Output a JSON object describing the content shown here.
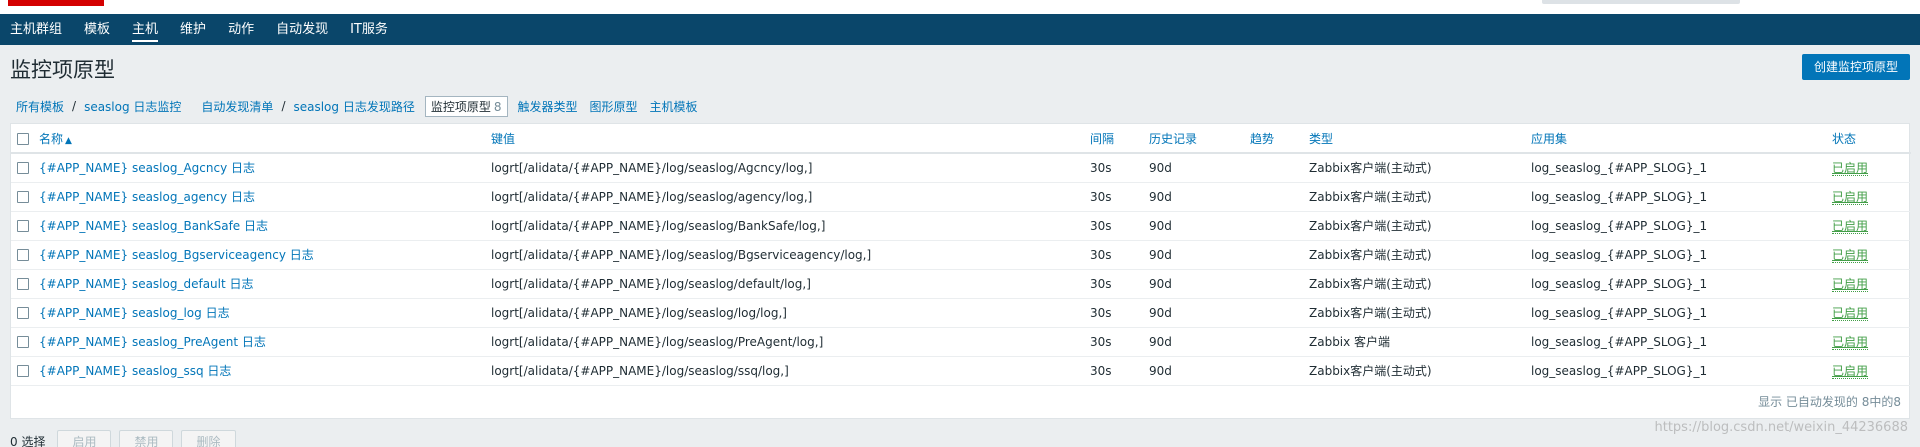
{
  "nav": {
    "items": [
      {
        "label": "主机群组",
        "active": false
      },
      {
        "label": "模板",
        "active": false
      },
      {
        "label": "主机",
        "active": true
      },
      {
        "label": "维护",
        "active": false
      },
      {
        "label": "动作",
        "active": false
      },
      {
        "label": "自动发现",
        "active": false
      },
      {
        "label": "IT服务",
        "active": false
      }
    ]
  },
  "page": {
    "title": "监控项原型",
    "create_button": "创建监控项原型"
  },
  "breadcrumbs": {
    "all_templates": "所有模板",
    "sep": "/",
    "template": "seaslog 日志监控",
    "discovery_list": "自动发现清单",
    "discovery_rule": "seaslog 日志发现路径",
    "current_tab": "监控项原型",
    "current_count": "8",
    "trigger_prototypes": "触发器类型",
    "graph_prototypes": "图形原型",
    "host_prototypes": "主机模板"
  },
  "table": {
    "headers": {
      "name": "名称",
      "sort_indicator": "▲",
      "key": "键值",
      "interval": "间隔",
      "history": "历史记录",
      "trends": "趋势",
      "type": "类型",
      "applications": "应用集",
      "status": "状态"
    },
    "rows": [
      {
        "name": "{#APP_NAME} seaslog_Agcncy 日志",
        "key": "logrt[/alidata/{#APP_NAME}/log/seaslog/Agcncy/log,]",
        "interval": "30s",
        "history": "90d",
        "trends": "",
        "type": "Zabbix客户端(主动式)",
        "app": "log_seaslog_{#APP_SLOG}_1",
        "status": "已启用"
      },
      {
        "name": "{#APP_NAME} seaslog_agency 日志",
        "key": "logrt[/alidata/{#APP_NAME}/log/seaslog/agency/log,]",
        "interval": "30s",
        "history": "90d",
        "trends": "",
        "type": "Zabbix客户端(主动式)",
        "app": "log_seaslog_{#APP_SLOG}_1",
        "status": "已启用"
      },
      {
        "name": "{#APP_NAME} seaslog_BankSafe 日志",
        "key": "logrt[/alidata/{#APP_NAME}/log/seaslog/BankSafe/log,]",
        "interval": "30s",
        "history": "90d",
        "trends": "",
        "type": "Zabbix客户端(主动式)",
        "app": "log_seaslog_{#APP_SLOG}_1",
        "status": "已启用"
      },
      {
        "name": "{#APP_NAME} seaslog_Bgserviceagency 日志",
        "key": "logrt[/alidata/{#APP_NAME}/log/seaslog/Bgserviceagency/log,]",
        "interval": "30s",
        "history": "90d",
        "trends": "",
        "type": "Zabbix客户端(主动式)",
        "app": "log_seaslog_{#APP_SLOG}_1",
        "status": "已启用"
      },
      {
        "name": "{#APP_NAME} seaslog_default 日志",
        "key": "logrt[/alidata/{#APP_NAME}/log/seaslog/default/log,]",
        "interval": "30s",
        "history": "90d",
        "trends": "",
        "type": "Zabbix客户端(主动式)",
        "app": "log_seaslog_{#APP_SLOG}_1",
        "status": "已启用"
      },
      {
        "name": "{#APP_NAME} seaslog_log 日志",
        "key": "logrt[/alidata/{#APP_NAME}/log/seaslog/log/log,]",
        "interval": "30s",
        "history": "90d",
        "trends": "",
        "type": "Zabbix客户端(主动式)",
        "app": "log_seaslog_{#APP_SLOG}_1",
        "status": "已启用"
      },
      {
        "name": "{#APP_NAME} seaslog_PreAgent 日志",
        "key": "logrt[/alidata/{#APP_NAME}/log/seaslog/PreAgent/log,]",
        "interval": "30s",
        "history": "90d",
        "trends": "",
        "type": "Zabbix 客户端",
        "app": "log_seaslog_{#APP_SLOG}_1",
        "status": "已启用"
      },
      {
        "name": "{#APP_NAME} seaslog_ssq 日志",
        "key": "logrt[/alidata/{#APP_NAME}/log/seaslog/ssq/log,]",
        "interval": "30s",
        "history": "90d",
        "trends": "",
        "type": "Zabbix客户端(主动式)",
        "app": "log_seaslog_{#APP_SLOG}_1",
        "status": "已启用"
      }
    ],
    "footer": "显示 已自动发现的 8中的8"
  },
  "actions": {
    "selected": "0 选择",
    "enable": "启用",
    "disable": "禁用",
    "delete": "删除"
  },
  "watermark": "https://blog.csdn.net/weixin_44236688",
  "colors": {
    "navbar": "#0a466a",
    "link": "#0275b8",
    "enabled": "#429e47",
    "background": "#ebeef0"
  }
}
